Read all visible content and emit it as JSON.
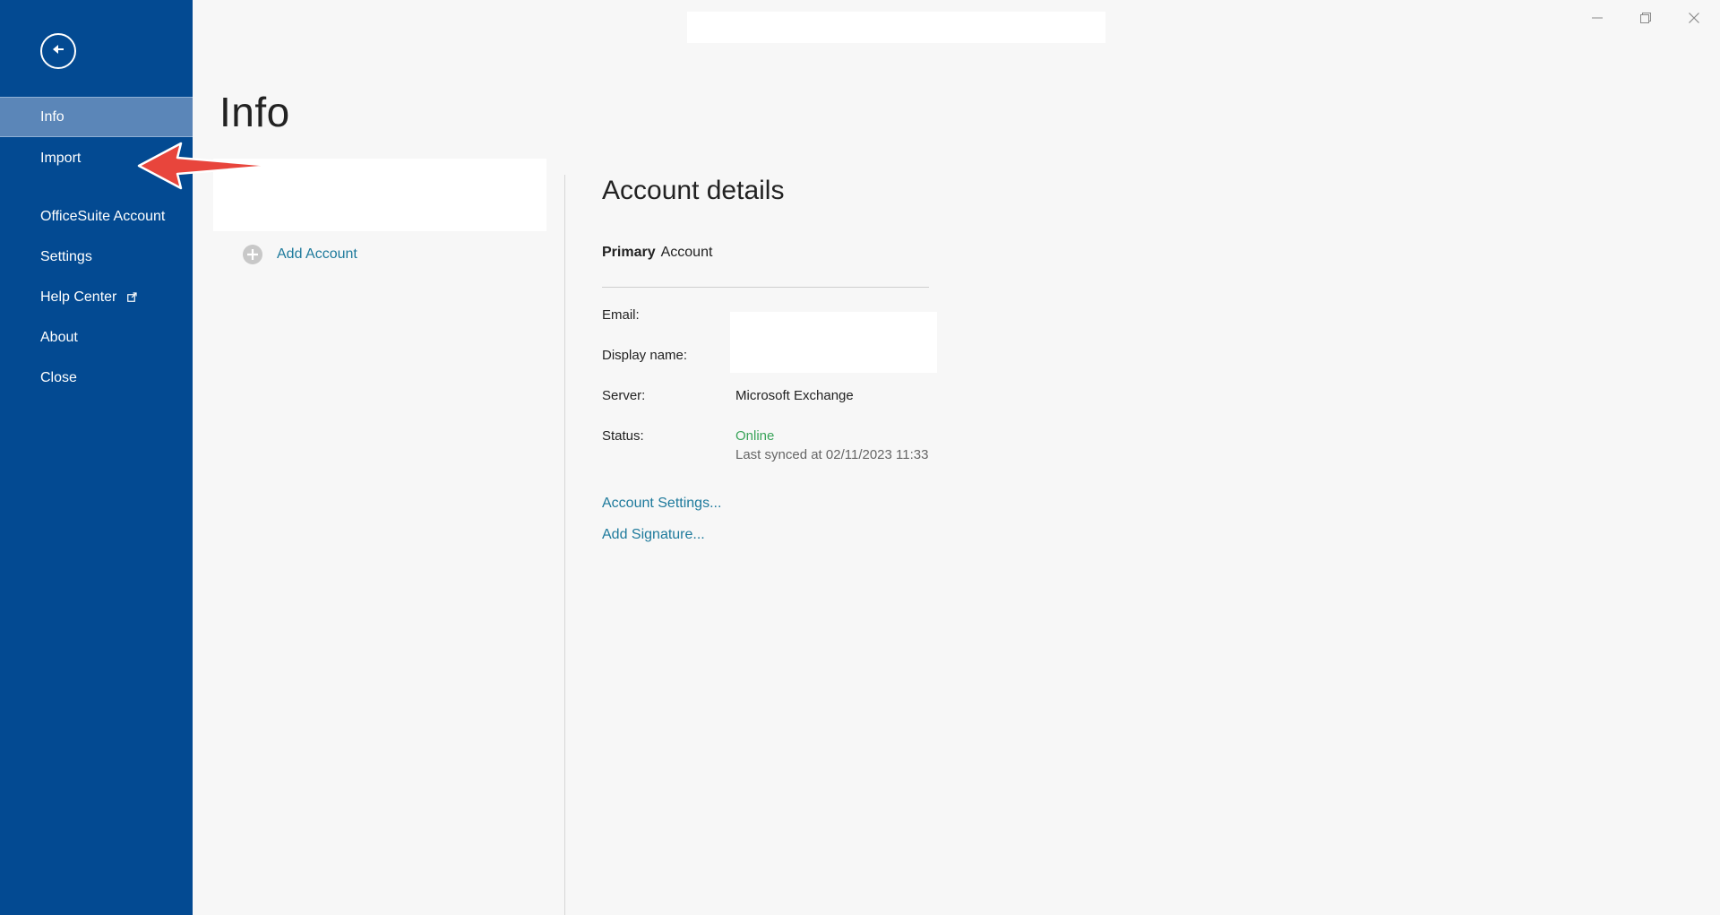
{
  "sidebar": {
    "items": [
      {
        "label": "Info"
      },
      {
        "label": "Import"
      },
      {
        "label": "OfficeSuite Account"
      },
      {
        "label": "Settings"
      },
      {
        "label": "Help Center"
      },
      {
        "label": "About"
      },
      {
        "label": "Close"
      }
    ],
    "active_item": "Info",
    "background_color": "#034a92",
    "active_color": "#5b86b8"
  },
  "icons": {
    "back": "arrow-left-icon",
    "external_link": "external-link-icon",
    "add": "plus-circle-icon",
    "window_controls": [
      "minimize-icon",
      "restore-icon",
      "close-icon"
    ]
  },
  "main": {
    "title": "Info",
    "add_account_label": "Add Account"
  },
  "details": {
    "title": "Account details",
    "primary_bold": "Primary",
    "primary_rest": "Account",
    "fields": [
      {
        "label": "Email:",
        "value": ""
      },
      {
        "label": "Display name:",
        "value": ""
      },
      {
        "label": "Server:",
        "value": "Microsoft Exchange"
      },
      {
        "label": "Status:",
        "value": "Online",
        "subvalue": "Last synced at 02/11/2023 11:33"
      }
    ],
    "links": {
      "account_settings": "Account Settings...",
      "add_signature": "Add Signature..."
    },
    "link_color": "#1e7a9c",
    "online_color": "#3aa45a"
  }
}
